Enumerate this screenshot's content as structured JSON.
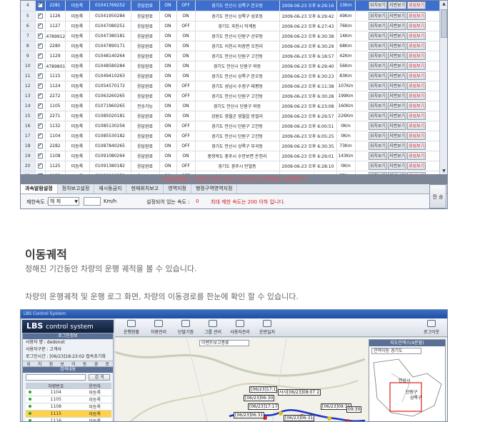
{
  "top_grid": {
    "rows": [
      {
        "no": "4",
        "id": "2281",
        "status": "미등록",
        "phone": "01041769252",
        "resp": "응답완료",
        "p1": "ON",
        "p2": "OFF",
        "addr": "경기도 안산시 상록구 본오동",
        "time": "2009-06-23 오후 6:29:16",
        "speed": "13Km",
        "selected": true
      },
      {
        "no": "5",
        "id": "1126",
        "status": "미등록",
        "phone": "01041950284",
        "resp": "응답완료",
        "p1": "ON",
        "p2": "ON",
        "addr": "경기도 안산시 상록구 성포동",
        "time": "2009-06-23 오후 6:29:42",
        "speed": "49Km"
      },
      {
        "no": "6",
        "id": "1127",
        "status": "미등록",
        "phone": "01047080251",
        "resp": "응답완료",
        "p1": "ON",
        "p2": "OFF",
        "addr": "경기도 과천시 막계동",
        "time": "2009-06-23 오후 6:27:43",
        "speed": "76Km"
      },
      {
        "no": "7",
        "id": "4789912(임",
        "status": "미등록",
        "phone": "01047380181",
        "resp": "응답완료",
        "p1": "ON",
        "p2": "ON",
        "addr": "경기도 안산시 단원구 선부동",
        "time": "2009-06-23 오후 6:30:38",
        "speed": "14Km"
      },
      {
        "no": "8",
        "id": "2280",
        "status": "미등록",
        "phone": "01047890171",
        "resp": "응답완료",
        "p1": "ON",
        "p2": "ON",
        "addr": "경기도 이천시 마장면 오천리",
        "time": "2009-06-23 오후 6:30:29",
        "speed": "68Km"
      },
      {
        "no": "9",
        "id": "1129",
        "status": "미등록",
        "phone": "01048140264",
        "resp": "응답완료",
        "p1": "ON",
        "p2": "ON",
        "addr": "경기도 안산시 단원구 고잔동",
        "time": "2009-06-23 오후 6:18:57",
        "speed": "42Km"
      },
      {
        "no": "10",
        "id": "4789801(임",
        "status": "미등록",
        "phone": "01048580284",
        "resp": "응답완료",
        "p1": "ON",
        "p2": "ON",
        "addr": "경기도 안산시 단원구 와동",
        "time": "2009-06-23 오후 6:29:40",
        "speed": "56Km"
      },
      {
        "no": "11",
        "id": "1115",
        "status": "미등록",
        "phone": "01049410263",
        "resp": "응답완료",
        "p1": "ON",
        "p2": "ON",
        "addr": "경기도 안산시 상록구 본오동",
        "time": "2009-06-23 오후 6:30:23",
        "speed": "83Km"
      },
      {
        "no": "12",
        "id": "1124",
        "status": "미등록",
        "phone": "01054570172",
        "resp": "응답완료",
        "p1": "ON",
        "p2": "OFF",
        "addr": "경기도 성남시 수정구 태평동",
        "time": "2009-06-23 오후 6:11:38",
        "speed": "107Km"
      },
      {
        "no": "13",
        "id": "2272",
        "status": "미등록",
        "phone": "01063260265",
        "resp": "응답완료",
        "p1": "ON",
        "p2": "OFF",
        "addr": "경기도 안산시 단원구 고잔동",
        "time": "2009-06-23 오후 6:30:28",
        "speed": "199Km"
      },
      {
        "no": "14",
        "id": "1105",
        "status": "미등록",
        "phone": "01071960265",
        "resp": "전송가능",
        "p1": "ON",
        "p2": "ON",
        "addr": "경기도 안산시 단원구 와동",
        "time": "2009-06-23 오후 6:23:08",
        "speed": "160Km"
      },
      {
        "no": "15",
        "id": "2271",
        "status": "미등록",
        "phone": "01085020181",
        "resp": "응답완료",
        "p1": "ON",
        "p2": "ON",
        "addr": "강원도 영월군 영월읍 방절리",
        "time": "2009-06-23 오후 6:29:57",
        "speed": "226Km"
      },
      {
        "no": "16",
        "id": "1132",
        "status": "미등록",
        "phone": "01085130256",
        "resp": "응답완료",
        "p1": "ON",
        "p2": "OFF",
        "addr": "경기도 안산시 단원구 고잔동",
        "time": "2009-06-23 오후 6:00:51",
        "speed": "0Km"
      },
      {
        "no": "17",
        "id": "1104",
        "status": "미등록",
        "phone": "01085530182",
        "resp": "응답완료",
        "p1": "ON",
        "p2": "OFF",
        "addr": "경기도 안산시 단원구 고잔동",
        "time": "2009-06-23 오후 6:05:25",
        "speed": "0Km"
      },
      {
        "no": "18",
        "id": "2282",
        "status": "미등록",
        "phone": "01087840265",
        "resp": "응답완료",
        "p1": "ON",
        "p2": "OFF",
        "addr": "경기도 안산시 상록구 부곡동",
        "time": "2009-06-23 오후 6:30:35",
        "speed": "73Km"
      },
      {
        "no": "19",
        "id": "1108",
        "status": "미등록",
        "phone": "01091080264",
        "resp": "응답완료",
        "p1": "ON",
        "p2": "ON",
        "addr": "충청북도 충주시 수안보면 온천리",
        "time": "2009-06-23 오후 6:29:01",
        "speed": "143Km"
      },
      {
        "no": "20",
        "id": "1125",
        "status": "미등록",
        "phone": "01091380182",
        "resp": "응답완료",
        "p1": "ON",
        "p2": "OFF",
        "addr": "경기도 광주시 탄벌동",
        "time": "2009-06-23 오후 6:28:10",
        "speed": "0Km"
      },
      {
        "no": "21",
        "id": "1133",
        "status": "미등록",
        "phone": "01091990251",
        "resp": "응답완료",
        "p1": "ON",
        "p2": "OFF",
        "addr": "경기도 안산시 단원구 와동",
        "time": "2009-06-23 오후 6:26:34",
        "speed": "77Km"
      }
    ],
    "row_buttons": {
      "view": "위치보기",
      "map": "지번보기",
      "sat": "위성보기"
    },
    "alert_text": "과속알람설정 - 지정된 속도이상으로 10초이상 차량이동시 알려줍니다",
    "tabs": [
      "과속알람설정",
      "정차보고설정",
      "재시동금지",
      "현재위치보고",
      "영역지정",
      "행정구역영역지정"
    ],
    "speed_label": "제한속도 :",
    "speed_select": "해 제",
    "speed_unit": "Km/h",
    "current_label": "설정되어 있는 속도 :",
    "current_value": "0",
    "max_note": "최대 제한 속도는 200 이하 입니다.",
    "save_label": "전 송"
  },
  "section": {
    "title": "이동궤적",
    "desc1": "정해진 기간동안 차량의 운행 궤적을 볼 수 있습니다.",
    "desc2": "차량의 운행궤적 및 운행 로그 화면, 차량의 이동경로를 한눈에 확인 할 수 있습니다."
  },
  "app": {
    "window_title": "LBS Control System",
    "brand": "LBS",
    "brand_sub": "control system",
    "toolbar": [
      "운행현황",
      "차량관리",
      "단말기정",
      "그룹 관리",
      "사용자관리",
      "운반일지"
    ],
    "logout": "로그아웃",
    "left_header": "로그인정보",
    "user_id": "사용자 명 : dodonot",
    "user_level": "사용자구분 : 고객사",
    "login_time": "로그인시간 : [06/23]18:23:02",
    "login_note": "접속초기화",
    "nav": [
      "위",
      "치",
      "정",
      "보",
      "이",
      "동",
      "경",
      "로"
    ],
    "search_header": "검색내용",
    "search_btn": "검 색",
    "list_headers": [
      "",
      "차량번호",
      "운전자"
    ],
    "list": [
      {
        "no": "1104",
        "drv": "미등록"
      },
      {
        "no": "1105",
        "drv": "미등록"
      },
      {
        "no": "1108",
        "drv": "미등록"
      },
      {
        "no": "1115",
        "drv": "미등록",
        "hl": true
      },
      {
        "no": "1116",
        "drv": "미등록"
      }
    ],
    "event_select": "이벤트보고종류",
    "mini_header": "지도인덱스(4분할)",
    "mini_region": "경기도",
    "mini_select": "관역이동",
    "mini_labels": [
      "안산시",
      "상록구",
      "단원구"
    ],
    "map_labels": [
      "[06/23]17:1",
      "[06/23]06:30",
      "사시[06/23]08:07 2",
      "[06/23]17:17",
      "[06/23]09:31",
      "09:30",
      "[06/23]06:31",
      "[06/23]06:31"
    ]
  },
  "colors": {
    "selected_row": "#3d6fd0",
    "alert_text": "#ff4b4b",
    "red_button": "#d01919",
    "route": "#1a34c7"
  }
}
